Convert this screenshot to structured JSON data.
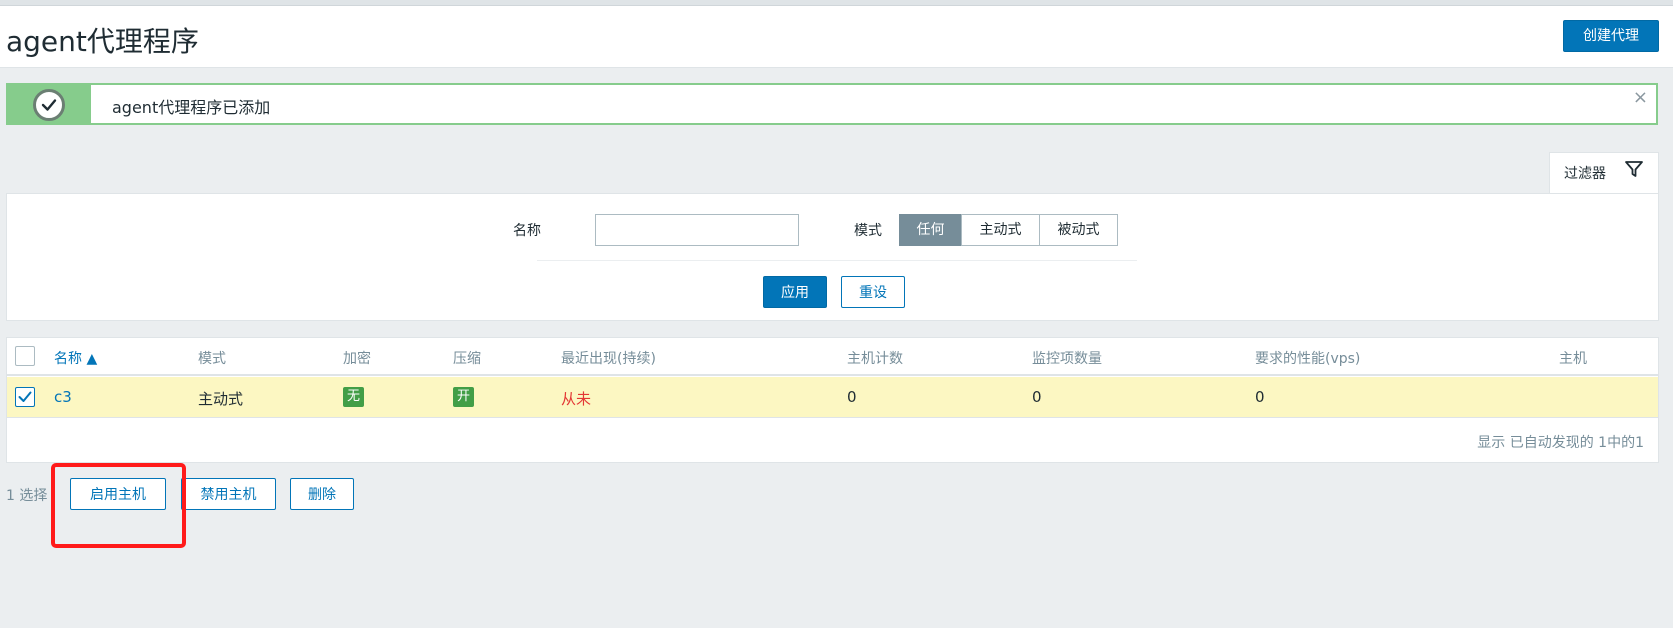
{
  "header": {
    "title": "agent代理程序",
    "create_button": "创建代理"
  },
  "message": {
    "text": "agent代理程序已添加",
    "close": "×",
    "status_color": "#86cc8c"
  },
  "filter": {
    "tab_label": "过滤器",
    "name_label": "名称",
    "name_value": "",
    "mode_label": "模式",
    "mode_options": [
      "任何",
      "主动式",
      "被动式"
    ],
    "mode_selected": "任何",
    "apply": "应用",
    "reset": "重设"
  },
  "table": {
    "columns": [
      "名称 ▲",
      "模式",
      "加密",
      "压缩",
      "最近出现(持续)",
      "主机计数",
      "监控项数量",
      "要求的性能(vps)",
      "主机"
    ],
    "rows": [
      {
        "name": "c3",
        "mode": "主动式",
        "encryption": "无",
        "compression": "开",
        "last_seen": "从未",
        "host_count": "0",
        "item_count": "0",
        "required_vps": "0",
        "hosts": "",
        "checked": true
      }
    ],
    "footer": "显示 已自动发现的 1中的1"
  },
  "actions": {
    "selected_count": "1 选择",
    "enable": "启用主机",
    "disable": "禁用主机",
    "delete": "删除"
  },
  "colors": {
    "accent": "#0275b8",
    "row_highlight": "#fcf7c2",
    "badge_green": "#429e47",
    "never_red": "#e33734",
    "annotation_red": "#ff1a1a"
  }
}
